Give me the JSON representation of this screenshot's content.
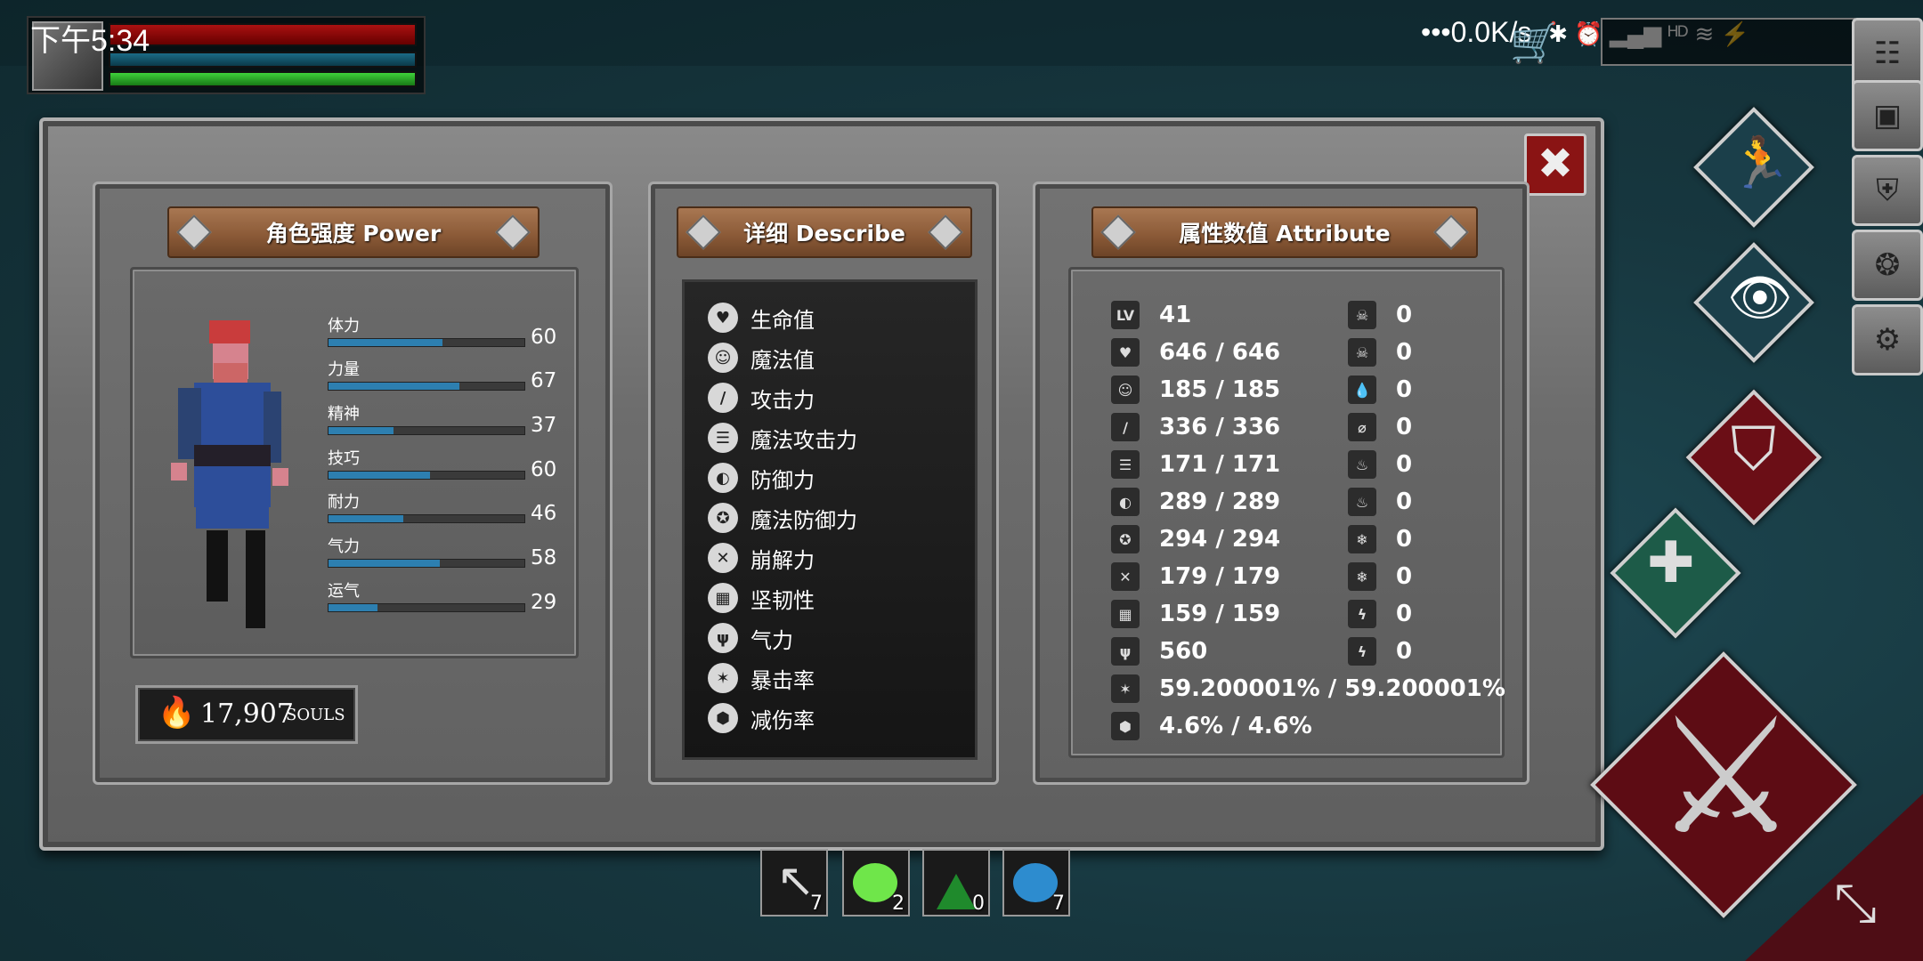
{
  "status_bar": {
    "time": "下午5:34",
    "network": "•••0.0K/s",
    "extras": "✱ ⏰ ▂▄▆ ᴴᴰ ≋ ⚡"
  },
  "panels": {
    "power": {
      "title": "角色强度 Power",
      "stats": [
        {
          "label": "体力",
          "value": "60",
          "level": 0.58
        },
        {
          "label": "力量",
          "value": "67",
          "level": 0.67
        },
        {
          "label": "精神",
          "value": "37",
          "level": 0.33
        },
        {
          "label": "技巧",
          "value": "60",
          "level": 0.52
        },
        {
          "label": "耐力",
          "value": "46",
          "level": 0.38
        },
        {
          "label": "气力",
          "value": "58",
          "level": 0.57
        },
        {
          "label": "运气",
          "value": "29",
          "level": 0.25
        }
      ],
      "souls": {
        "amount": "17,907",
        "unit": "SOULS"
      }
    },
    "describe": {
      "title": "详细 Describe",
      "items": [
        {
          "label": "生命值",
          "icon": "heart-icon"
        },
        {
          "label": "魔法值",
          "icon": "head-icon"
        },
        {
          "label": "攻击力",
          "icon": "sword-icon"
        },
        {
          "label": "魔法攻击力",
          "icon": "spellbook-icon"
        },
        {
          "label": "防御力",
          "icon": "shield-icon"
        },
        {
          "label": "魔法防御力",
          "icon": "magic-shield-icon"
        },
        {
          "label": "崩解力",
          "icon": "hammer-icon"
        },
        {
          "label": "坚韧性",
          "icon": "helmet-icon"
        },
        {
          "label": "气力",
          "icon": "lungs-icon"
        },
        {
          "label": "暴击率",
          "icon": "critical-star-icon"
        },
        {
          "label": "减伤率",
          "icon": "damage-reduction-icon"
        }
      ]
    },
    "attribute": {
      "title": "属性数值 Attribute",
      "left": [
        {
          "icon": "level-icon",
          "icon_text": "LV",
          "value": "41"
        },
        {
          "icon": "heart-icon",
          "value": "646 / 646"
        },
        {
          "icon": "head-icon",
          "value": "185 / 185"
        },
        {
          "icon": "sword-icon",
          "value": "336 / 336"
        },
        {
          "icon": "spellbook-icon",
          "value": "171 / 171"
        },
        {
          "icon": "shield-icon",
          "value": "289 / 289"
        },
        {
          "icon": "magic-shield-icon",
          "value": "294 / 294"
        },
        {
          "icon": "hammer-icon",
          "value": "179 / 179"
        },
        {
          "icon": "helmet-icon",
          "value": "159 / 159"
        },
        {
          "icon": "lungs-icon",
          "value": "560"
        },
        {
          "icon": "critical-star-icon",
          "value": "59.200001% / 59.200001%"
        },
        {
          "icon": "damage-reduction-icon",
          "value": "4.6% / 4.6%"
        }
      ],
      "right": [
        {
          "icon": "skull-icon",
          "value": "0"
        },
        {
          "icon": "skull-resist-icon",
          "value": "0"
        },
        {
          "icon": "drop-icon",
          "value": "0"
        },
        {
          "icon": "drop-resist-icon",
          "value": "0"
        },
        {
          "icon": "fire-icon",
          "value": "0"
        },
        {
          "icon": "fire-resist-icon",
          "value": "0"
        },
        {
          "icon": "frost-icon",
          "value": "0"
        },
        {
          "icon": "frost-resist-icon",
          "value": "0"
        },
        {
          "icon": "lightning-icon",
          "value": "0"
        },
        {
          "icon": "lightning-resist-icon",
          "value": "0"
        }
      ]
    }
  },
  "hotbar": [
    {
      "name": "arrow-slot",
      "count": "7"
    },
    {
      "name": "green-potion-slot",
      "count": "2"
    },
    {
      "name": "green-flask-slot",
      "count": "0"
    },
    {
      "name": "blue-potion-slot",
      "count": "7"
    }
  ],
  "colors": {
    "hp": "#a11111",
    "mp": "#1b6b86",
    "stamina": "#3ed13a",
    "stat_bar": "#2d7fb0",
    "banner": "#8c5b38",
    "close": "#8a1414"
  }
}
